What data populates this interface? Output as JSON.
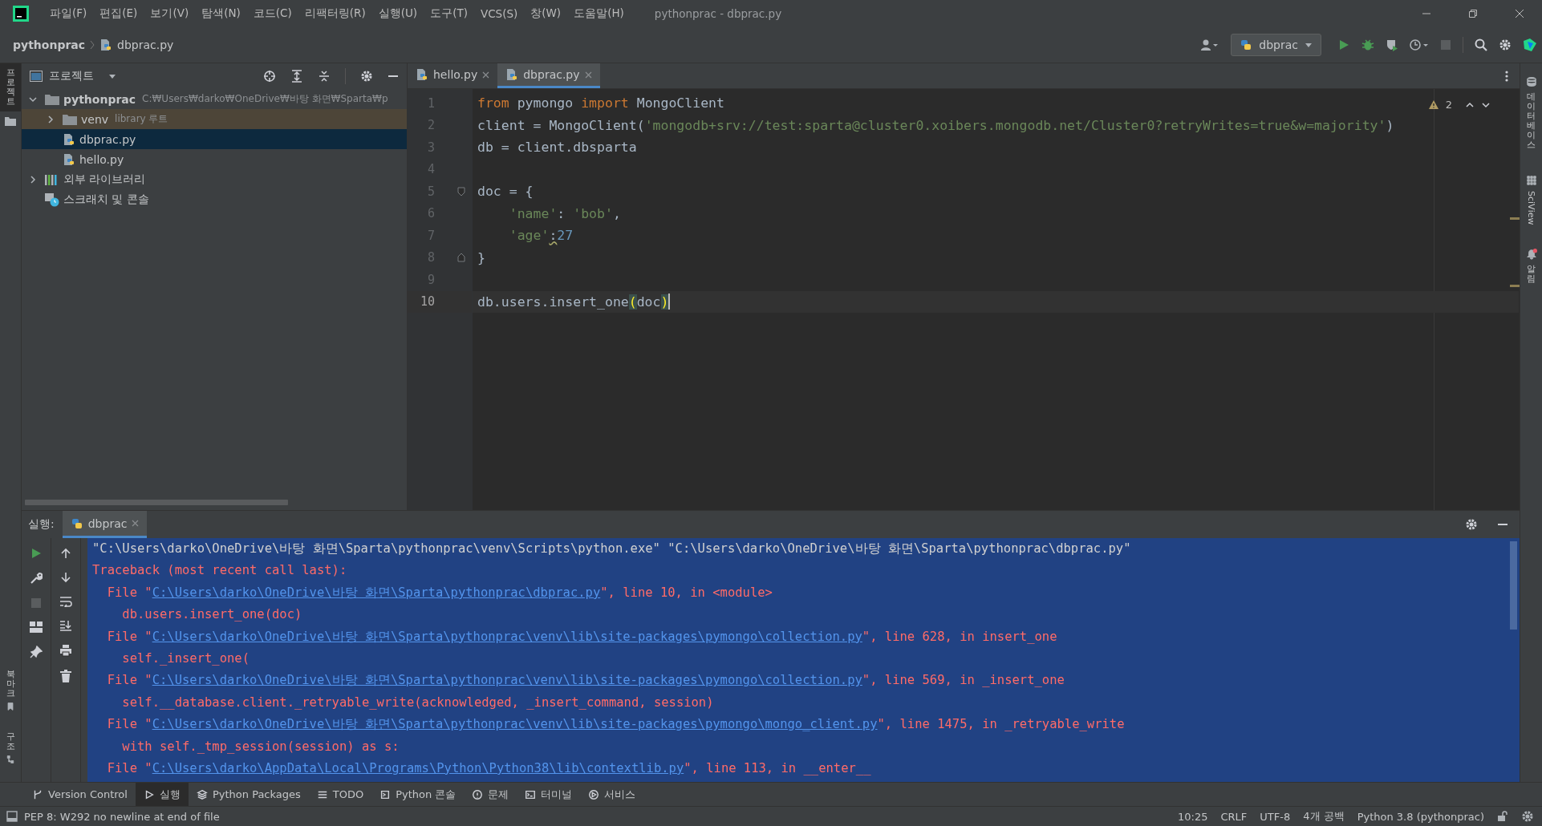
{
  "window": {
    "title": "pythonprac - dbprac.py"
  },
  "menu": [
    "파일(F)",
    "편집(E)",
    "보기(V)",
    "탐색(N)",
    "코드(C)",
    "리팩터링(R)",
    "실행(U)",
    "도구(T)",
    "VCS(S)",
    "창(W)",
    "도움말(H)"
  ],
  "breadcrumbs": [
    "pythonprac",
    "dbprac.py"
  ],
  "run_config": {
    "name": "dbprac"
  },
  "left_stripe": {
    "top": [
      {
        "label": "프로젝트",
        "selected": true
      }
    ],
    "bottom": [
      {
        "label": "북마크",
        "kind": "bookmarks"
      },
      {
        "label": "구조",
        "kind": "structure"
      }
    ]
  },
  "project": {
    "title": "프로젝트",
    "tree": [
      {
        "name": "pythonprac",
        "hint": "C:₩Users₩darko₩OneDrive₩바탕 화면₩Sparta₩p",
        "kind": "project_folder",
        "expanded": true,
        "selected": false,
        "children": [
          {
            "name": "venv",
            "hint": "library 루트",
            "kind": "library_folder",
            "expanded": false,
            "selected": false
          },
          {
            "name": "dbprac.py",
            "kind": "file",
            "selected": true
          },
          {
            "name": "hello.py",
            "kind": "file",
            "selected": false
          }
        ]
      },
      {
        "name": "외부 라이브러리",
        "kind": "libraries",
        "expanded": false,
        "selected": false
      },
      {
        "name": "스크래치 및 콘솔",
        "kind": "scratches",
        "selected": false
      }
    ]
  },
  "editor": {
    "tabs": [
      {
        "label": "hello.py",
        "selected": false
      },
      {
        "label": "dbprac.py",
        "selected": true
      }
    ],
    "warnings": "2",
    "lines": [
      {
        "number": "1",
        "current": false,
        "tokens": [
          {
            "t": "from",
            "kind": "kw"
          },
          {
            "t": " pymongo ",
            "kind": "plain"
          },
          {
            "t": "import",
            "kind": "kw"
          },
          {
            "t": " MongoClient",
            "kind": "plain"
          }
        ]
      },
      {
        "number": "2",
        "current": false,
        "tokens": [
          {
            "t": "client = MongoClient(",
            "kind": "plain"
          },
          {
            "t": "'mongodb+srv://test:sparta@cluster0.xoibers.mongodb.net/Cluster0?retryWrites=true&w=majority'",
            "kind": "str"
          },
          {
            "t": ")",
            "kind": "plain"
          }
        ]
      },
      {
        "number": "3",
        "current": false,
        "tokens": [
          {
            "t": "db = client.dbsparta",
            "kind": "plain"
          }
        ]
      },
      {
        "number": "4",
        "current": false
      },
      {
        "number": "5",
        "current": false,
        "fold_start": true,
        "tokens": [
          {
            "t": "doc = {",
            "kind": "plain"
          }
        ]
      },
      {
        "number": "6",
        "current": false,
        "tokens": [
          {
            "t": "    'name'",
            "kind": "str"
          },
          {
            "t": ": ",
            "kind": "plain"
          },
          {
            "t": "'bob'",
            "kind": "str"
          },
          {
            "t": ",",
            "kind": "plain"
          }
        ]
      },
      {
        "number": "7",
        "current": false,
        "tokens": [
          {
            "t": "    'age'",
            "kind": "str"
          },
          {
            "t": ":",
            "kind": "warn"
          },
          {
            "t": "27",
            "kind": "num"
          }
        ]
      },
      {
        "number": "8",
        "current": false,
        "fold_end": true,
        "tokens": [
          {
            "t": "}",
            "kind": "plain"
          }
        ]
      },
      {
        "number": "9",
        "current": false
      },
      {
        "number": "10",
        "current": true,
        "tokens": [
          {
            "t": "db.users.insert_one",
            "kind": "plain"
          },
          {
            "t": "(",
            "kind": "brace"
          },
          {
            "t": "doc",
            "kind": "plain"
          },
          {
            "t": ")",
            "kind": "brace"
          }
        ]
      }
    ]
  },
  "run": {
    "label": "실행:",
    "tab": "dbprac",
    "console": [
      [
        {
          "t": "\"C:\\Users\\darko\\OneDrive\\바탕 화면\\Sparta\\pythonprac\\venv\\Scripts\\python.exe\" \"C:\\Users\\darko\\OneDrive\\바탕 화면\\Sparta\\pythonprac\\dbprac.py\"",
          "kind": "cmd"
        }
      ],
      [
        {
          "t": "Traceback (most recent call last):",
          "kind": "err"
        }
      ],
      [
        {
          "t": "  File \"",
          "kind": "err"
        },
        {
          "t": "C:\\Users\\darko\\OneDrive\\바탕 화면\\Sparta\\pythonprac\\dbprac.py",
          "kind": "link"
        },
        {
          "t": "\", line 10, in <module>",
          "kind": "err"
        }
      ],
      [
        {
          "t": "    db.users.insert_one(doc)",
          "kind": "err"
        }
      ],
      [
        {
          "t": "  File \"",
          "kind": "err"
        },
        {
          "t": "C:\\Users\\darko\\OneDrive\\바탕 화면\\Sparta\\pythonprac\\venv\\lib\\site-packages\\pymongo\\collection.py",
          "kind": "link"
        },
        {
          "t": "\", line 628, in insert_one",
          "kind": "err"
        }
      ],
      [
        {
          "t": "    self._insert_one(",
          "kind": "err"
        }
      ],
      [
        {
          "t": "  File \"",
          "kind": "err"
        },
        {
          "t": "C:\\Users\\darko\\OneDrive\\바탕 화면\\Sparta\\pythonprac\\venv\\lib\\site-packages\\pymongo\\collection.py",
          "kind": "link"
        },
        {
          "t": "\", line 569, in _insert_one",
          "kind": "err"
        }
      ],
      [
        {
          "t": "    self.__database.client._retryable_write(acknowledged, _insert_command, session)",
          "kind": "err"
        }
      ],
      [
        {
          "t": "  File \"",
          "kind": "err"
        },
        {
          "t": "C:\\Users\\darko\\OneDrive\\바탕 화면\\Sparta\\pythonprac\\venv\\lib\\site-packages\\pymongo\\mongo_client.py",
          "kind": "link"
        },
        {
          "t": "\", line 1475, in _retryable_write",
          "kind": "err"
        }
      ],
      [
        {
          "t": "    with self._tmp_session(session) as s:",
          "kind": "err"
        }
      ],
      [
        {
          "t": "  File \"",
          "kind": "err"
        },
        {
          "t": "C:\\Users\\darko\\AppData\\Local\\Programs\\Python\\Python38\\lib\\contextlib.py",
          "kind": "link"
        },
        {
          "t": "\", line 113, in __enter__",
          "kind": "err"
        }
      ]
    ]
  },
  "right_stripe": [
    {
      "label": "데이터베이스",
      "kind": "database"
    },
    {
      "label": "SciView",
      "kind": "sciview"
    },
    {
      "label": "알림",
      "kind": "notifications"
    }
  ],
  "tool_windows": [
    {
      "label": "Version Control",
      "kind": "vcs",
      "selected": false
    },
    {
      "label": "실행",
      "kind": "run",
      "selected": true
    },
    {
      "label": "Python Packages",
      "kind": "packages",
      "selected": false
    },
    {
      "label": "TODO",
      "kind": "todo",
      "selected": false
    },
    {
      "label": "Python 콘솔",
      "kind": "console",
      "selected": false
    },
    {
      "label": "문제",
      "kind": "problems",
      "selected": false
    },
    {
      "label": "터미널",
      "kind": "terminal",
      "selected": false
    },
    {
      "label": "서비스",
      "kind": "services",
      "selected": false
    }
  ],
  "status": {
    "message": "PEP 8: W292 no newline at end of file",
    "items": [
      "10:25",
      "CRLF",
      "UTF-8",
      "4개 공백",
      "Python 3.8 (pythonprac)"
    ]
  }
}
